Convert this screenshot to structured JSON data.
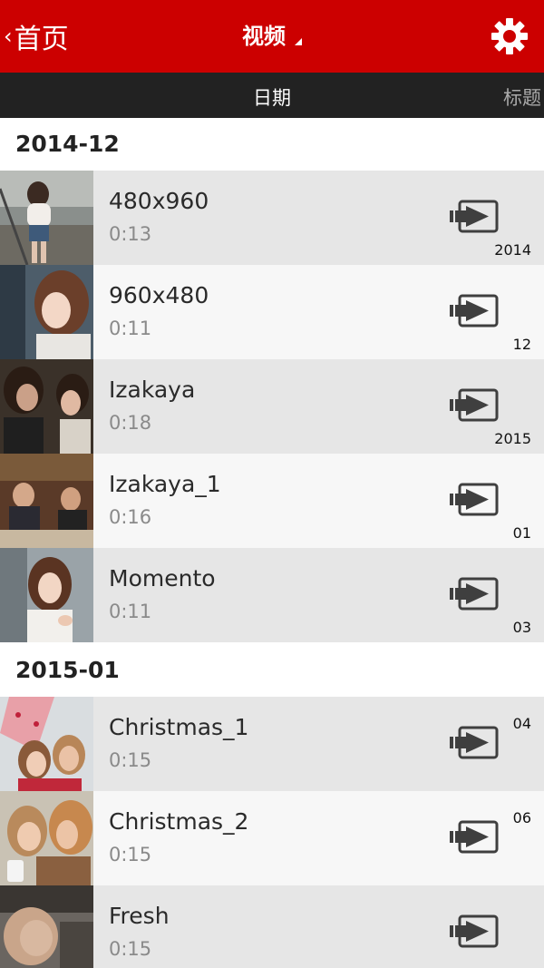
{
  "header": {
    "back_label": "首页",
    "title": "视频"
  },
  "tabs": {
    "date": "日期",
    "title": "标题"
  },
  "sections": [
    {
      "label": "2014-12"
    },
    {
      "label": "2015-01"
    }
  ],
  "videos": [
    {
      "name": "480x960",
      "duration": "0:13",
      "side_label": "2014"
    },
    {
      "name": "960x480",
      "duration": "0:11",
      "side_label": "12"
    },
    {
      "name": "Izakaya",
      "duration": "0:18",
      "side_label": "2015"
    },
    {
      "name": "Izakaya_1",
      "duration": "0:16",
      "side_label": "01"
    },
    {
      "name": "Momento",
      "duration": "0:11",
      "side_label": "03"
    },
    {
      "name": "Christmas_1",
      "duration": "0:15",
      "side_label": "04"
    },
    {
      "name": "Christmas_2",
      "duration": "0:15",
      "side_label": "06"
    },
    {
      "name": "Fresh",
      "duration": "0:15",
      "side_label": ""
    }
  ],
  "icons": {
    "back": "chevron-left-icon",
    "title_dropdown": "dropdown-caret-icon",
    "settings": "gear-icon",
    "play": "play-to-screen-icon"
  },
  "colors": {
    "header_bg": "#cc0000",
    "tabbar_bg": "#222222",
    "row_odd": "#e6e6e6",
    "row_even": "#f7f7f7"
  }
}
